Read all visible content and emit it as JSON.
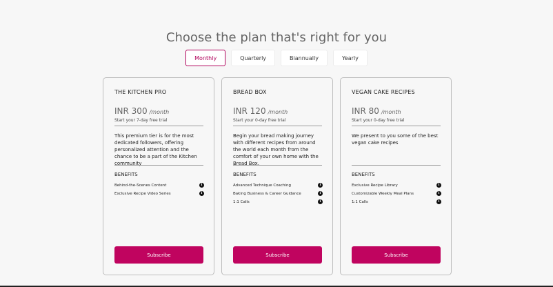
{
  "header": {
    "title": "Choose the plan that's right for you"
  },
  "tabs": [
    {
      "label": "Monthly",
      "active": true
    },
    {
      "label": "Quarterly",
      "active": false
    },
    {
      "label": "Biannually",
      "active": false
    },
    {
      "label": "Yearly",
      "active": false
    }
  ],
  "plans": [
    {
      "name": "THE KITCHEN PRO",
      "price": "INR 300",
      "period": "/month",
      "trial": "Start your 7-day free trial",
      "description": "This premium tier is for the most dedicated followers, offering personalized attention and the chance to be a part of the Kitchen community",
      "benefits_title": "BENEFITS",
      "benefits": [
        "Behind-the-Scenes Content",
        "Exclusive Recipe Video Series"
      ],
      "cta": "Subscribe"
    },
    {
      "name": "BREAD BOX",
      "price": "INR 120",
      "period": "/month",
      "trial": "Start your 0-day free trial",
      "description": "Begin your bread making journey with different recipes from around the world each month from the comfort of your own home with the Bread Box.",
      "benefits_title": "BENEFITS",
      "benefits": [
        "Advanced Technique Coaching",
        "Baking Business & Career Guidance",
        "1:1 Calls"
      ],
      "cta": "Subscribe"
    },
    {
      "name": "VEGAN CAKE RECIPES",
      "price": "INR 80",
      "period": "/month",
      "trial": "Start your 0-day free trial",
      "description": "We present to you some of the best vegan cake recipes",
      "benefits_title": "BENEFITS",
      "benefits": [
        "Exclusive Recipe Library",
        "Customizable Weekly Meal Plans",
        "1:1 Calls"
      ],
      "cta": "Subscribe"
    }
  ],
  "colors": {
    "accent": "#c0045f",
    "background": "#f7f7f7"
  },
  "icons": {
    "benefit_info": "info-icon"
  }
}
